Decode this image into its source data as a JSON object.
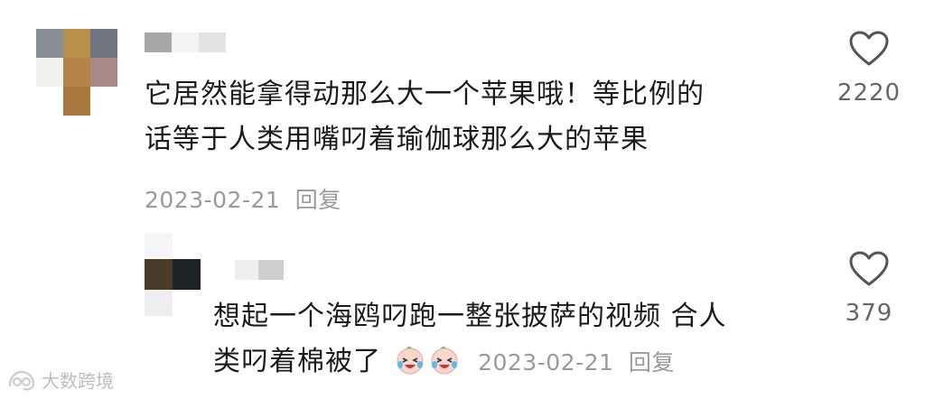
{
  "comments": [
    {
      "line1": "它居然能拿得动那么大一个苹果哦！等比例的",
      "line2": "话等于人类用嘴叼着瑜伽球那么大的苹果",
      "date": "2023-02-21",
      "reply_label": "回复",
      "likes": "2220",
      "like_icon": "heart-outline-icon"
    },
    {
      "line1": "想起一个海鸥叼跑一整张披萨的视频 合人",
      "line2": "类叼着棉被了",
      "emoji": "crying-laughing-face",
      "date": "2023-02-21",
      "reply_label": "回复",
      "likes": "379",
      "like_icon": "heart-outline-icon"
    }
  ],
  "watermark": {
    "text": "大数跨境"
  },
  "colors": {
    "text": "#1b1b1b",
    "meta": "#9a9a9a",
    "count": "#666666",
    "background": "#ffffff"
  }
}
